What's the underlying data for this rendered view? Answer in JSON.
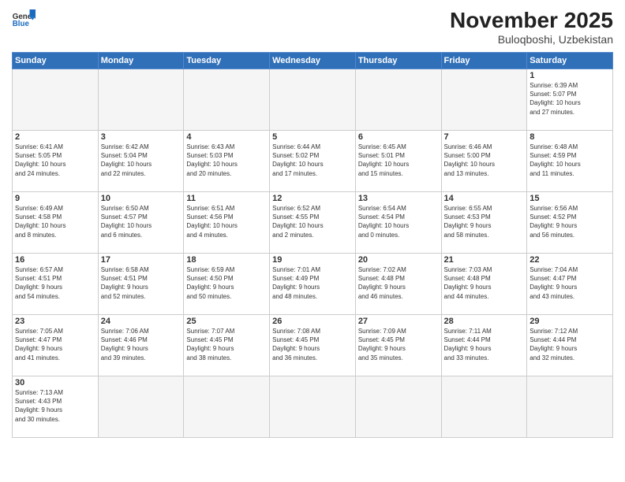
{
  "header": {
    "logo": {
      "general": "General",
      "blue": "Blue"
    },
    "title": "November 2025",
    "location": "Buloqboshi, Uzbekistan"
  },
  "days_of_week": [
    "Sunday",
    "Monday",
    "Tuesday",
    "Wednesday",
    "Thursday",
    "Friday",
    "Saturday"
  ],
  "weeks": [
    [
      {
        "day": "",
        "info": ""
      },
      {
        "day": "",
        "info": ""
      },
      {
        "day": "",
        "info": ""
      },
      {
        "day": "",
        "info": ""
      },
      {
        "day": "",
        "info": ""
      },
      {
        "day": "",
        "info": ""
      },
      {
        "day": "1",
        "info": "Sunrise: 6:39 AM\nSunset: 5:07 PM\nDaylight: 10 hours\nand 27 minutes."
      }
    ],
    [
      {
        "day": "2",
        "info": "Sunrise: 6:41 AM\nSunset: 5:05 PM\nDaylight: 10 hours\nand 24 minutes."
      },
      {
        "day": "3",
        "info": "Sunrise: 6:42 AM\nSunset: 5:04 PM\nDaylight: 10 hours\nand 22 minutes."
      },
      {
        "day": "4",
        "info": "Sunrise: 6:43 AM\nSunset: 5:03 PM\nDaylight: 10 hours\nand 20 minutes."
      },
      {
        "day": "5",
        "info": "Sunrise: 6:44 AM\nSunset: 5:02 PM\nDaylight: 10 hours\nand 17 minutes."
      },
      {
        "day": "6",
        "info": "Sunrise: 6:45 AM\nSunset: 5:01 PM\nDaylight: 10 hours\nand 15 minutes."
      },
      {
        "day": "7",
        "info": "Sunrise: 6:46 AM\nSunset: 5:00 PM\nDaylight: 10 hours\nand 13 minutes."
      },
      {
        "day": "8",
        "info": "Sunrise: 6:48 AM\nSunset: 4:59 PM\nDaylight: 10 hours\nand 11 minutes."
      }
    ],
    [
      {
        "day": "9",
        "info": "Sunrise: 6:49 AM\nSunset: 4:58 PM\nDaylight: 10 hours\nand 8 minutes."
      },
      {
        "day": "10",
        "info": "Sunrise: 6:50 AM\nSunset: 4:57 PM\nDaylight: 10 hours\nand 6 minutes."
      },
      {
        "day": "11",
        "info": "Sunrise: 6:51 AM\nSunset: 4:56 PM\nDaylight: 10 hours\nand 4 minutes."
      },
      {
        "day": "12",
        "info": "Sunrise: 6:52 AM\nSunset: 4:55 PM\nDaylight: 10 hours\nand 2 minutes."
      },
      {
        "day": "13",
        "info": "Sunrise: 6:54 AM\nSunset: 4:54 PM\nDaylight: 10 hours\nand 0 minutes."
      },
      {
        "day": "14",
        "info": "Sunrise: 6:55 AM\nSunset: 4:53 PM\nDaylight: 9 hours\nand 58 minutes."
      },
      {
        "day": "15",
        "info": "Sunrise: 6:56 AM\nSunset: 4:52 PM\nDaylight: 9 hours\nand 56 minutes."
      }
    ],
    [
      {
        "day": "16",
        "info": "Sunrise: 6:57 AM\nSunset: 4:51 PM\nDaylight: 9 hours\nand 54 minutes."
      },
      {
        "day": "17",
        "info": "Sunrise: 6:58 AM\nSunset: 4:51 PM\nDaylight: 9 hours\nand 52 minutes."
      },
      {
        "day": "18",
        "info": "Sunrise: 6:59 AM\nSunset: 4:50 PM\nDaylight: 9 hours\nand 50 minutes."
      },
      {
        "day": "19",
        "info": "Sunrise: 7:01 AM\nSunset: 4:49 PM\nDaylight: 9 hours\nand 48 minutes."
      },
      {
        "day": "20",
        "info": "Sunrise: 7:02 AM\nSunset: 4:48 PM\nDaylight: 9 hours\nand 46 minutes."
      },
      {
        "day": "21",
        "info": "Sunrise: 7:03 AM\nSunset: 4:48 PM\nDaylight: 9 hours\nand 44 minutes."
      },
      {
        "day": "22",
        "info": "Sunrise: 7:04 AM\nSunset: 4:47 PM\nDaylight: 9 hours\nand 43 minutes."
      }
    ],
    [
      {
        "day": "23",
        "info": "Sunrise: 7:05 AM\nSunset: 4:47 PM\nDaylight: 9 hours\nand 41 minutes."
      },
      {
        "day": "24",
        "info": "Sunrise: 7:06 AM\nSunset: 4:46 PM\nDaylight: 9 hours\nand 39 minutes."
      },
      {
        "day": "25",
        "info": "Sunrise: 7:07 AM\nSunset: 4:45 PM\nDaylight: 9 hours\nand 38 minutes."
      },
      {
        "day": "26",
        "info": "Sunrise: 7:08 AM\nSunset: 4:45 PM\nDaylight: 9 hours\nand 36 minutes."
      },
      {
        "day": "27",
        "info": "Sunrise: 7:09 AM\nSunset: 4:45 PM\nDaylight: 9 hours\nand 35 minutes."
      },
      {
        "day": "28",
        "info": "Sunrise: 7:11 AM\nSunset: 4:44 PM\nDaylight: 9 hours\nand 33 minutes."
      },
      {
        "day": "29",
        "info": "Sunrise: 7:12 AM\nSunset: 4:44 PM\nDaylight: 9 hours\nand 32 minutes."
      }
    ],
    [
      {
        "day": "30",
        "info": "Sunrise: 7:13 AM\nSunset: 4:43 PM\nDaylight: 9 hours\nand 30 minutes."
      },
      {
        "day": "",
        "info": ""
      },
      {
        "day": "",
        "info": ""
      },
      {
        "day": "",
        "info": ""
      },
      {
        "day": "",
        "info": ""
      },
      {
        "day": "",
        "info": ""
      },
      {
        "day": "",
        "info": ""
      }
    ]
  ]
}
